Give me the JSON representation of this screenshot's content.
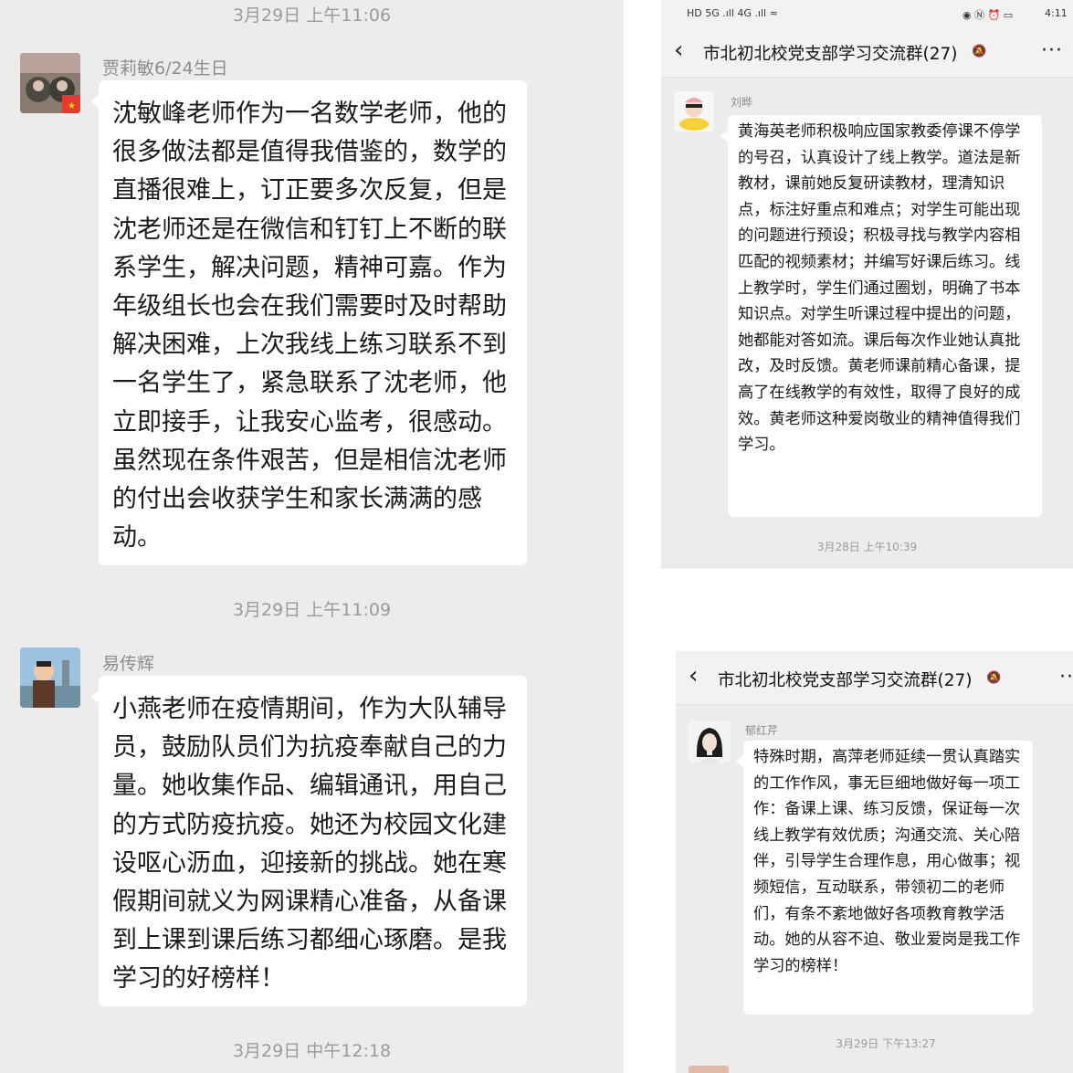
{
  "left_chat": {
    "top_timestamp": "3月29日 上午11:06",
    "messages": [
      {
        "sender": "贾莉敏6/24生日",
        "text": "沈敏峰老师作为一名数学老师，他的很多做法都是值得我借鉴的，数学的直播很难上，订正要多次反复，但是沈老师还是在微信和钉钉上不断的联系学生，解决问题，精神可嘉。作为年级组长也会在我们需要时及时帮助解决困难，上次我线上练习联系不到一名学生了，紧急联系了沈老师，他立即接手，让我安心监考，很感动。虽然现在条件艰苦，但是相信沈老师的付出会收获学生和家长满满的感动。",
        "timestamp_after": "3月29日 上午11:09"
      },
      {
        "sender": "易传辉",
        "text": "小燕老师在疫情期间，作为大队辅导员，鼓励队员们为抗疫奉献自己的力量。她收集作品、编辑通讯，用自己的方式防疫抗疫。她还为校园文化建设呕心沥血，迎接新的挑战。她在寒假期间就义为网课精心准备，从备课到上课到课后练习都细心琢磨。是我学习的好榜样！",
        "timestamp_after": "3月29日 中午12:18"
      }
    ]
  },
  "top_right_phone": {
    "status": {
      "left": "HD 5G .ıll 4G .ıll ≈",
      "time": "4:11"
    },
    "header": {
      "back": "‹",
      "title": "市北初北校党支部学习交流群(27)",
      "more": "···"
    },
    "message": {
      "sender": "刘晔",
      "text": "黄海英老师积极响应国家教委停课不停学的号召，认真设计了线上教学。道法是新教材，课前她反复研读教材，理清知识点，标注好重点和难点；对学生可能出现的问题进行预设；积极寻找与教学内容相匹配的视频素材；并编写好课后练习。线上教学时，学生们通过圈划，明确了书本知识点。对学生听课过程中提出的问题，她都能对答如流。课后每次作业她认真批改，及时反馈。黄老师课前精心备课，提高了在线教学的有效性，取得了良好的成效。黄老师这种爱岗敬业的精神值得我们学习。",
      "timestamp_after": "3月28日 上午10:39"
    }
  },
  "bottom_right_phone": {
    "header": {
      "back": "‹",
      "title": "市北初北校党支部学习交流群(27)",
      "more": "··"
    },
    "message": {
      "sender": "郁红芹",
      "text": "特殊时期，高萍老师延续一贯认真踏实的工作作风，事无巨细地做好每一项工作：备课上课、练习反馈，保证每一次线上教学有效优质；沟通交流、关心陪伴，引导学生合理作息，用心做事；视频短信，互动联系，带领初二的老师们，有条不紊地做好各项教育教学活动。她的从容不迫、敬业爱岗是我工作学习的榜样！",
      "timestamp_after": "3月29日 下午13:27"
    }
  },
  "colors": {
    "chat_bg": "#ececec",
    "bubble": "#ffffff",
    "timestamp": "#9b9b9b"
  },
  "icons": [
    "back-arrow-icon",
    "mute-icon",
    "more-icon",
    "avatar"
  ]
}
